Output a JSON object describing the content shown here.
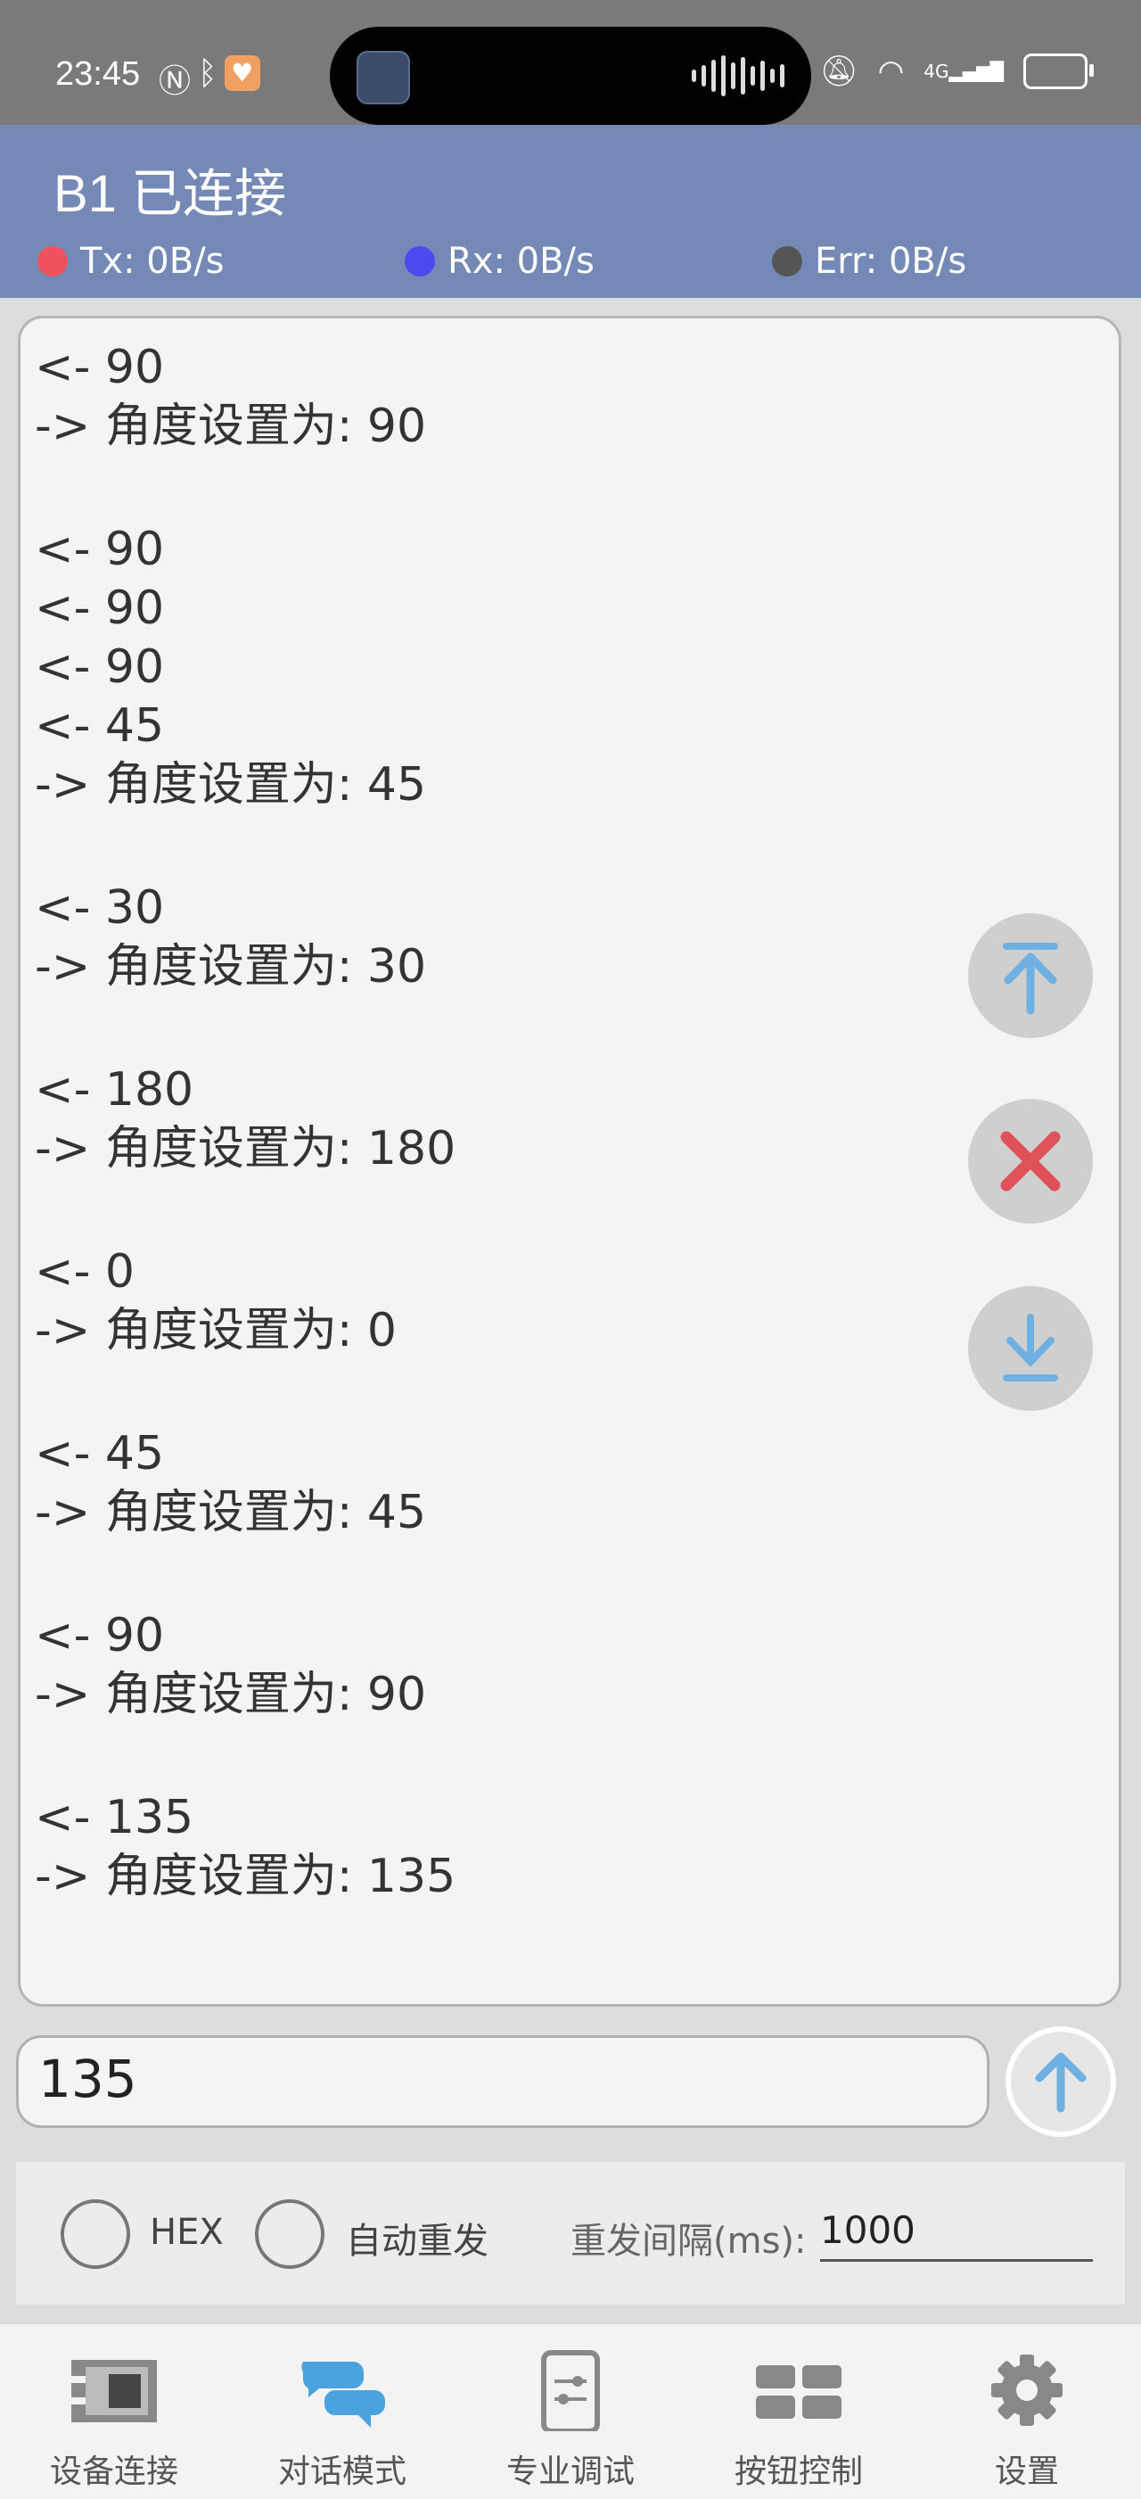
{
  "status_bar": {
    "time": "23:45",
    "signal": "4G"
  },
  "header": {
    "title": "B1 已连接",
    "tx": "Tx: 0B/s",
    "rx": "Rx: 0B/s",
    "err": "Err: 0B/s",
    "colors": {
      "tx": "#f0535e",
      "rx": "#4a4af0",
      "err": "#555555"
    }
  },
  "log": [
    "<- 90",
    "-> 角度设置为: 90",
    "",
    "<- 90",
    "<- 90",
    "<- 90",
    "<- 45",
    "-> 角度设置为: 45",
    "",
    "<- 30",
    "-> 角度设置为: 30",
    "",
    "<- 180",
    "-> 角度设置为: 180",
    "",
    "<- 0",
    "-> 角度设置为: 0",
    "",
    "<- 45",
    "-> 角度设置为: 45",
    "",
    "<- 90",
    "-> 角度设置为: 90",
    "",
    "<- 135",
    "-> 角度设置为: 135"
  ],
  "input": {
    "value": "135"
  },
  "options": {
    "hex_label": "HEX",
    "auto_resend_label": "自动重发",
    "interval_label": "重发间隔(ms):",
    "interval_value": "1000"
  },
  "nav": {
    "items": [
      {
        "label": "设备连接",
        "icon": "device-icon"
      },
      {
        "label": "对话模式",
        "icon": "chat-icon"
      },
      {
        "label": "专业调试",
        "icon": "sliders-icon"
      },
      {
        "label": "按钮控制",
        "icon": "grid-icon"
      },
      {
        "label": "设置",
        "icon": "gear-icon"
      }
    ],
    "active": 1,
    "active_color": "#4aa3df"
  }
}
